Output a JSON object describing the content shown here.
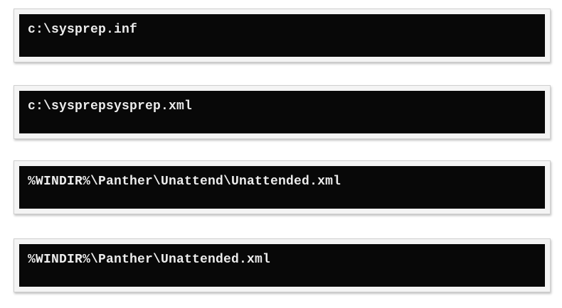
{
  "command_boxes": [
    {
      "text": "c:\\sysprep.inf"
    },
    {
      "text": "c:\\sysprepsysprep.xml"
    },
    {
      "text": "%WINDIR%\\Panther\\Unattend\\Unattended.xml"
    },
    {
      "text": "%WINDIR%\\Panther\\Unattended.xml"
    }
  ],
  "colors": {
    "terminal_background": "#080808",
    "terminal_text": "#ececec",
    "frame": "#f4f4f4"
  }
}
